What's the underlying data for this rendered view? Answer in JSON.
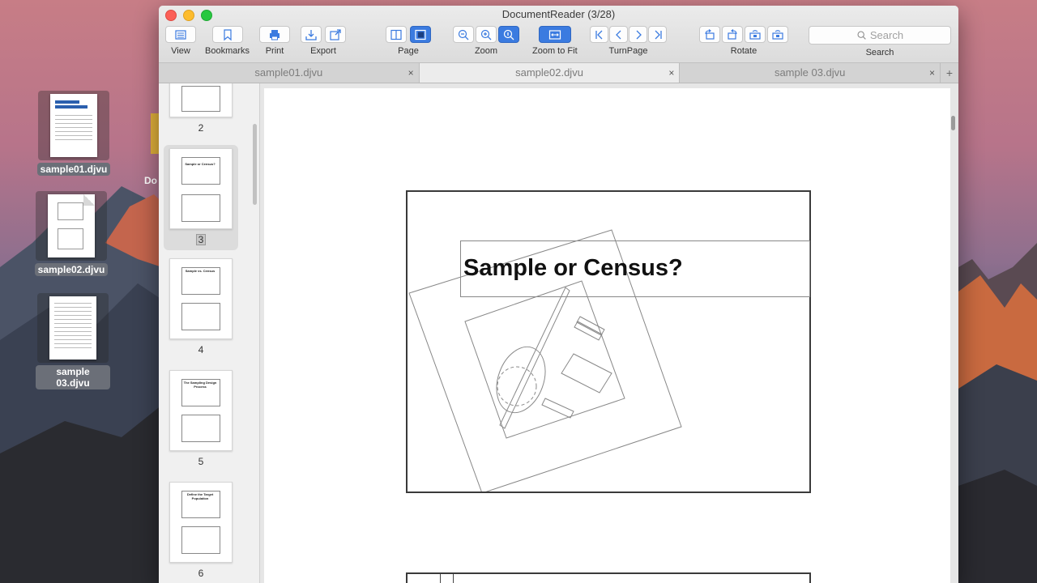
{
  "desktop": {
    "icons": [
      {
        "label": "sample01.djvu"
      },
      {
        "label": "sample02.djvu"
      },
      {
        "label": "sample 03.djvu"
      }
    ],
    "partial_label": "Do"
  },
  "window": {
    "title": "DocumentReader (3/28)",
    "toolbar": {
      "view_label": "View",
      "bookmarks_label": "Bookmarks",
      "print_label": "Print",
      "export_label": "Export",
      "page_label": "Page",
      "zoom_label": "Zoom",
      "zoom_to_fit_label": "Zoom to Fit",
      "turnpage_label": "TurnPage",
      "rotate_label": "Rotate",
      "search_placeholder": "Search",
      "search_label": "Search"
    },
    "tabs": [
      {
        "label": "sample01.djvu",
        "close": "×"
      },
      {
        "label": "sample02.djvu",
        "close": "×",
        "active": true
      },
      {
        "label": "sample 03.djvu",
        "close": "×"
      }
    ],
    "tab_add": "+"
  },
  "sidebar": {
    "pages": [
      {
        "number": "2"
      },
      {
        "number": "3",
        "selected": true,
        "title": "Sample or Census?"
      },
      {
        "number": "4",
        "title": "Sample vs. Census"
      },
      {
        "number": "5",
        "title": "The Sampling Design Process"
      },
      {
        "number": "6",
        "title": "Define the Target Population"
      }
    ]
  },
  "document": {
    "slide_title": "Sample or Census?"
  },
  "colors": {
    "accent": "#3b7be0",
    "close": "#fc5f57",
    "minimize": "#fdbc2e",
    "maximize": "#28c840"
  }
}
